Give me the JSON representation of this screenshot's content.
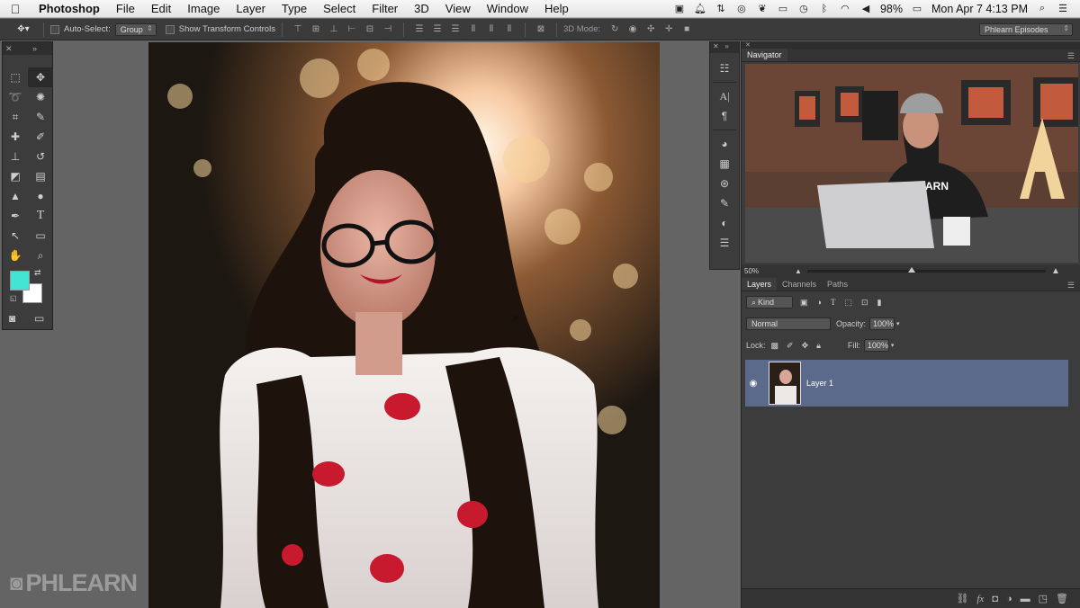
{
  "menubar": {
    "app_name": "Photoshop",
    "items": [
      "File",
      "Edit",
      "Image",
      "Layer",
      "Type",
      "Select",
      "Filter",
      "3D",
      "View",
      "Window",
      "Help"
    ],
    "battery": "98%",
    "clock": "Mon Apr 7  4:13 PM"
  },
  "options_bar": {
    "auto_select_label": "Auto-Select:",
    "auto_select_value": "Group",
    "transform_label": "Show Transform Controls",
    "mode_3d_label": "3D Mode:",
    "workspace_value": "Phlearn Episodes"
  },
  "navigator": {
    "tab": "Navigator",
    "zoom": "50%"
  },
  "layers_panel": {
    "tabs": [
      "Layers",
      "Channels",
      "Paths"
    ],
    "kind_label": "Kind",
    "blend_mode": "Normal",
    "opacity_label": "Opacity:",
    "opacity_value": "100%",
    "lock_label": "Lock:",
    "fill_label": "Fill:",
    "fill_value": "100%",
    "layers": [
      {
        "name": "Layer 1"
      }
    ]
  },
  "colors": {
    "foreground": "#42e3d0",
    "background": "#ffffff",
    "layer_selected": "#5b6a8a"
  },
  "watermark": "PHLEARN"
}
